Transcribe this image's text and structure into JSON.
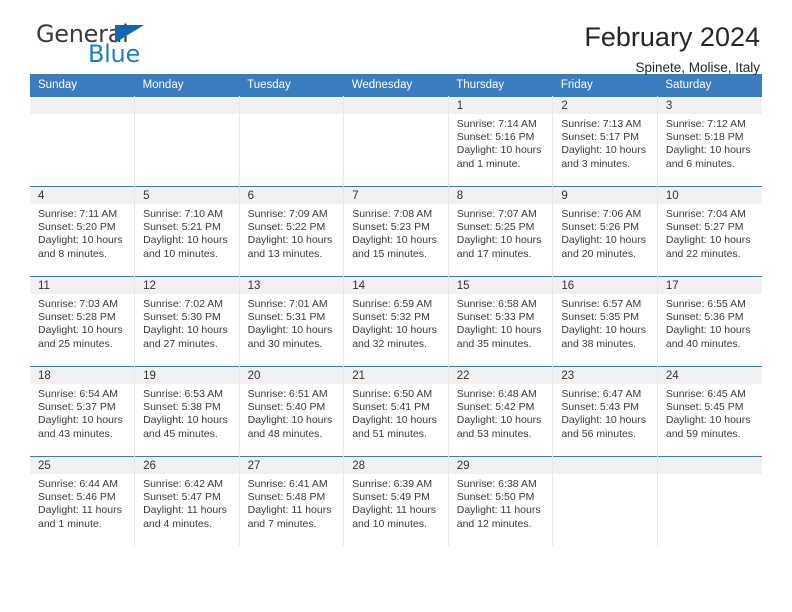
{
  "brand": {
    "name_part1": "General",
    "name_part2": "Blue",
    "accent_color": "#1f7fc4",
    "triangle_color": "#1567ad"
  },
  "header": {
    "title": "February 2024",
    "subtitle": "Spinete, Molise, Italy"
  },
  "calendar": {
    "header_color": "#3a7cc0",
    "weekday_headers": [
      "Sunday",
      "Monday",
      "Tuesday",
      "Wednesday",
      "Thursday",
      "Friday",
      "Saturday"
    ],
    "labels": {
      "sunrise": "Sunrise:",
      "sunset": "Sunset:",
      "daylight": "Daylight:"
    },
    "weeks": [
      [
        {
          "day": "",
          "empty": true
        },
        {
          "day": "",
          "empty": true
        },
        {
          "day": "",
          "empty": true
        },
        {
          "day": "",
          "empty": true
        },
        {
          "day": "1",
          "sunrise": "Sunrise: 7:14 AM",
          "sunset": "Sunset: 5:16 PM",
          "daylight_line1": "Daylight: 10 hours",
          "daylight_line2": "and 1 minute."
        },
        {
          "day": "2",
          "sunrise": "Sunrise: 7:13 AM",
          "sunset": "Sunset: 5:17 PM",
          "daylight_line1": "Daylight: 10 hours",
          "daylight_line2": "and 3 minutes."
        },
        {
          "day": "3",
          "sunrise": "Sunrise: 7:12 AM",
          "sunset": "Sunset: 5:18 PM",
          "daylight_line1": "Daylight: 10 hours",
          "daylight_line2": "and 6 minutes."
        }
      ],
      [
        {
          "day": "4",
          "sunrise": "Sunrise: 7:11 AM",
          "sunset": "Sunset: 5:20 PM",
          "daylight_line1": "Daylight: 10 hours",
          "daylight_line2": "and 8 minutes."
        },
        {
          "day": "5",
          "sunrise": "Sunrise: 7:10 AM",
          "sunset": "Sunset: 5:21 PM",
          "daylight_line1": "Daylight: 10 hours",
          "daylight_line2": "and 10 minutes."
        },
        {
          "day": "6",
          "sunrise": "Sunrise: 7:09 AM",
          "sunset": "Sunset: 5:22 PM",
          "daylight_line1": "Daylight: 10 hours",
          "daylight_line2": "and 13 minutes."
        },
        {
          "day": "7",
          "sunrise": "Sunrise: 7:08 AM",
          "sunset": "Sunset: 5:23 PM",
          "daylight_line1": "Daylight: 10 hours",
          "daylight_line2": "and 15 minutes."
        },
        {
          "day": "8",
          "sunrise": "Sunrise: 7:07 AM",
          "sunset": "Sunset: 5:25 PM",
          "daylight_line1": "Daylight: 10 hours",
          "daylight_line2": "and 17 minutes."
        },
        {
          "day": "9",
          "sunrise": "Sunrise: 7:06 AM",
          "sunset": "Sunset: 5:26 PM",
          "daylight_line1": "Daylight: 10 hours",
          "daylight_line2": "and 20 minutes."
        },
        {
          "day": "10",
          "sunrise": "Sunrise: 7:04 AM",
          "sunset": "Sunset: 5:27 PM",
          "daylight_line1": "Daylight: 10 hours",
          "daylight_line2": "and 22 minutes."
        }
      ],
      [
        {
          "day": "11",
          "sunrise": "Sunrise: 7:03 AM",
          "sunset": "Sunset: 5:28 PM",
          "daylight_line1": "Daylight: 10 hours",
          "daylight_line2": "and 25 minutes."
        },
        {
          "day": "12",
          "sunrise": "Sunrise: 7:02 AM",
          "sunset": "Sunset: 5:30 PM",
          "daylight_line1": "Daylight: 10 hours",
          "daylight_line2": "and 27 minutes."
        },
        {
          "day": "13",
          "sunrise": "Sunrise: 7:01 AM",
          "sunset": "Sunset: 5:31 PM",
          "daylight_line1": "Daylight: 10 hours",
          "daylight_line2": "and 30 minutes."
        },
        {
          "day": "14",
          "sunrise": "Sunrise: 6:59 AM",
          "sunset": "Sunset: 5:32 PM",
          "daylight_line1": "Daylight: 10 hours",
          "daylight_line2": "and 32 minutes."
        },
        {
          "day": "15",
          "sunrise": "Sunrise: 6:58 AM",
          "sunset": "Sunset: 5:33 PM",
          "daylight_line1": "Daylight: 10 hours",
          "daylight_line2": "and 35 minutes."
        },
        {
          "day": "16",
          "sunrise": "Sunrise: 6:57 AM",
          "sunset": "Sunset: 5:35 PM",
          "daylight_line1": "Daylight: 10 hours",
          "daylight_line2": "and 38 minutes."
        },
        {
          "day": "17",
          "sunrise": "Sunrise: 6:55 AM",
          "sunset": "Sunset: 5:36 PM",
          "daylight_line1": "Daylight: 10 hours",
          "daylight_line2": "and 40 minutes."
        }
      ],
      [
        {
          "day": "18",
          "sunrise": "Sunrise: 6:54 AM",
          "sunset": "Sunset: 5:37 PM",
          "daylight_line1": "Daylight: 10 hours",
          "daylight_line2": "and 43 minutes."
        },
        {
          "day": "19",
          "sunrise": "Sunrise: 6:53 AM",
          "sunset": "Sunset: 5:38 PM",
          "daylight_line1": "Daylight: 10 hours",
          "daylight_line2": "and 45 minutes."
        },
        {
          "day": "20",
          "sunrise": "Sunrise: 6:51 AM",
          "sunset": "Sunset: 5:40 PM",
          "daylight_line1": "Daylight: 10 hours",
          "daylight_line2": "and 48 minutes."
        },
        {
          "day": "21",
          "sunrise": "Sunrise: 6:50 AM",
          "sunset": "Sunset: 5:41 PM",
          "daylight_line1": "Daylight: 10 hours",
          "daylight_line2": "and 51 minutes."
        },
        {
          "day": "22",
          "sunrise": "Sunrise: 6:48 AM",
          "sunset": "Sunset: 5:42 PM",
          "daylight_line1": "Daylight: 10 hours",
          "daylight_line2": "and 53 minutes."
        },
        {
          "day": "23",
          "sunrise": "Sunrise: 6:47 AM",
          "sunset": "Sunset: 5:43 PM",
          "daylight_line1": "Daylight: 10 hours",
          "daylight_line2": "and 56 minutes."
        },
        {
          "day": "24",
          "sunrise": "Sunrise: 6:45 AM",
          "sunset": "Sunset: 5:45 PM",
          "daylight_line1": "Daylight: 10 hours",
          "daylight_line2": "and 59 minutes."
        }
      ],
      [
        {
          "day": "25",
          "sunrise": "Sunrise: 6:44 AM",
          "sunset": "Sunset: 5:46 PM",
          "daylight_line1": "Daylight: 11 hours",
          "daylight_line2": "and 1 minute."
        },
        {
          "day": "26",
          "sunrise": "Sunrise: 6:42 AM",
          "sunset": "Sunset: 5:47 PM",
          "daylight_line1": "Daylight: 11 hours",
          "daylight_line2": "and 4 minutes."
        },
        {
          "day": "27",
          "sunrise": "Sunrise: 6:41 AM",
          "sunset": "Sunset: 5:48 PM",
          "daylight_line1": "Daylight: 11 hours",
          "daylight_line2": "and 7 minutes."
        },
        {
          "day": "28",
          "sunrise": "Sunrise: 6:39 AM",
          "sunset": "Sunset: 5:49 PM",
          "daylight_line1": "Daylight: 11 hours",
          "daylight_line2": "and 10 minutes."
        },
        {
          "day": "29",
          "sunrise": "Sunrise: 6:38 AM",
          "sunset": "Sunset: 5:50 PM",
          "daylight_line1": "Daylight: 11 hours",
          "daylight_line2": "and 12 minutes."
        },
        {
          "day": "",
          "empty": true
        },
        {
          "day": "",
          "empty": true
        }
      ]
    ]
  }
}
